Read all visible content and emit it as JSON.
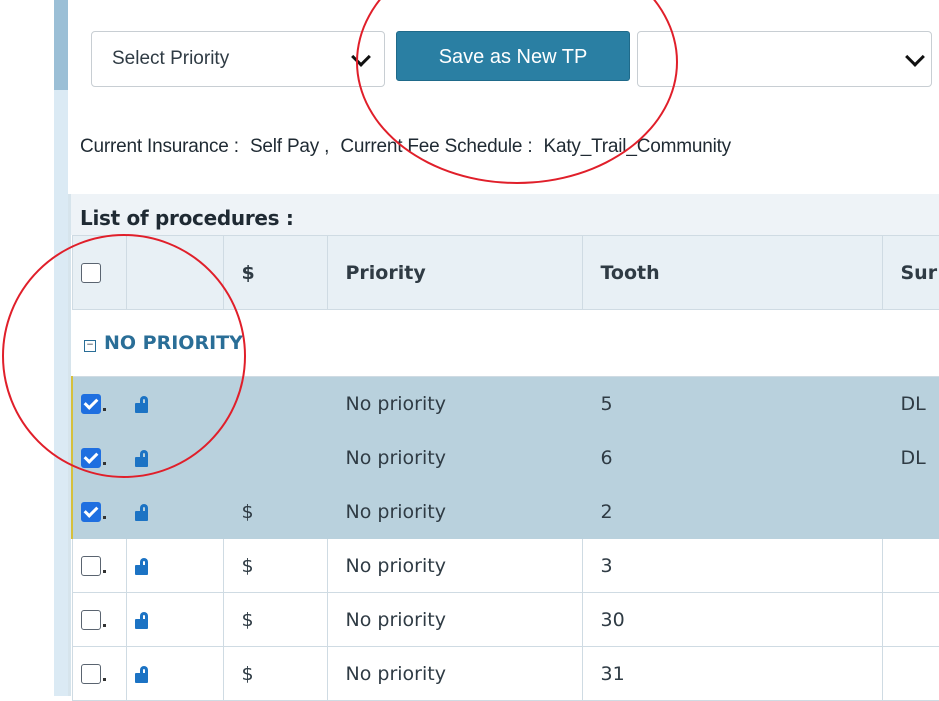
{
  "toolbar": {
    "priority_select": {
      "value": "Select Priority"
    },
    "save_button_label": "Save as New TP",
    "tp_select": {
      "value": ""
    }
  },
  "info": {
    "insurance_label": "Current Insurance :",
    "insurance_value": "Self Pay ,",
    "fee_label": "Current Fee Schedule :",
    "fee_value": "Katy_Trail_Community"
  },
  "procedures": {
    "title": "List of procedures :",
    "columns": [
      "",
      "",
      "$",
      "Priority",
      "Tooth",
      "Sur"
    ],
    "group_label": "NO PRIORITY",
    "rows": [
      {
        "checked": true,
        "fee": "",
        "priority": "No priority",
        "tooth": "5",
        "surface": "DL",
        "selected": true
      },
      {
        "checked": true,
        "fee": "",
        "priority": "No priority",
        "tooth": "6",
        "surface": "DL",
        "selected": true
      },
      {
        "checked": true,
        "fee": "$",
        "priority": "No priority",
        "tooth": "2",
        "surface": "",
        "selected": true
      },
      {
        "checked": false,
        "fee": "$",
        "priority": "No priority",
        "tooth": "3",
        "surface": "",
        "selected": false
      },
      {
        "checked": false,
        "fee": "$",
        "priority": "No priority",
        "tooth": "30",
        "surface": "",
        "selected": false
      },
      {
        "checked": false,
        "fee": "$",
        "priority": "No priority",
        "tooth": "31",
        "surface": "",
        "selected": false
      }
    ]
  },
  "colors": {
    "accent": "#2a7fa3",
    "selected_row": "#b9d1dd",
    "annotation": "#e01f2a",
    "lock": "#1c73c4"
  }
}
